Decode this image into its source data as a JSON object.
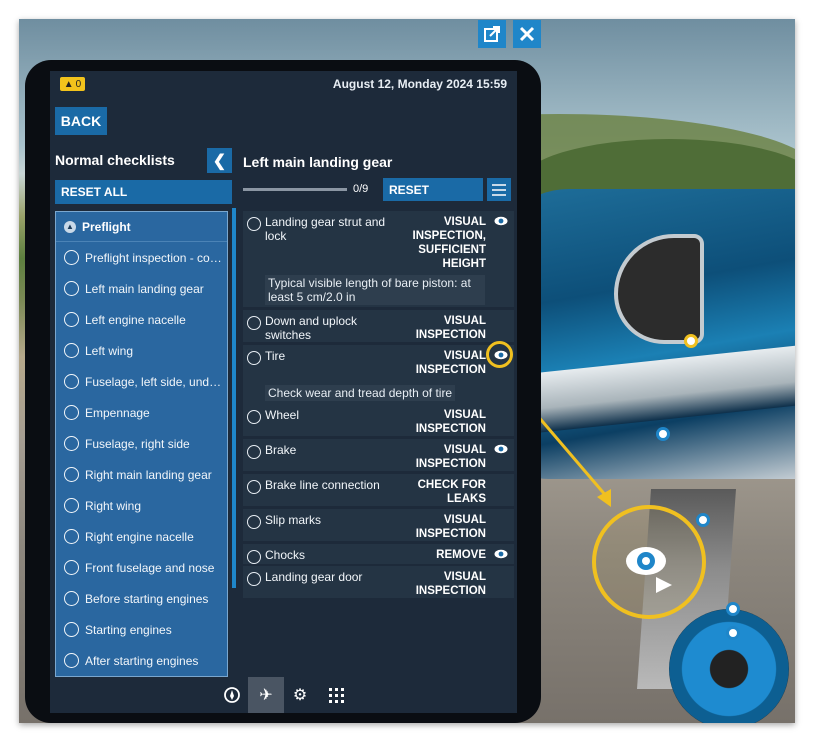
{
  "window": {
    "popout_icon": "popout-icon",
    "close_icon": "close-icon"
  },
  "tablet": {
    "notification_count": "0",
    "datetime": "August 12, Monday 2024 15:59",
    "back_label": "BACK",
    "left_panel": {
      "title": "Normal checklists",
      "reset_all_label": "RESET ALL",
      "group": "Preflight",
      "items": [
        "Preflight inspection - cockpit",
        "Left main landing gear",
        "Left engine nacelle",
        "Left wing",
        "Fuselage, left side, underside",
        "Empennage",
        "Fuselage, right side",
        "Right main landing gear",
        "Right wing",
        "Right engine nacelle",
        "Front fuselage and nose",
        "Before starting engines",
        "Starting engines",
        "After starting engines"
      ]
    },
    "right_panel": {
      "title": "Left main landing gear",
      "progress_text": "0/9",
      "progress_fraction": 0,
      "reset_label": "RESET",
      "checks": [
        {
          "label": "Landing gear strut and lock",
          "action": "VISUAL INSPECTION, SUFFICIENT HEIGHT",
          "eye": true,
          "note": "Typical visible length of bare piston: at least 5 cm/2.0 in"
        },
        {
          "label": "Down and uplock switches",
          "action": "VISUAL INSPECTION",
          "eye": false
        },
        {
          "label": "Tire",
          "action": "VISUAL INSPECTION",
          "eye": true,
          "note": "Check wear and tread depth of tire"
        },
        {
          "label": "Wheel",
          "action": "VISUAL INSPECTION",
          "eye": false
        },
        {
          "label": "Brake",
          "action": "VISUAL INSPECTION",
          "eye": true
        },
        {
          "label": "Brake line connection",
          "action": "CHECK FOR LEAKS",
          "eye": false
        },
        {
          "label": "Slip marks",
          "action": "VISUAL INSPECTION",
          "eye": false
        },
        {
          "label": "Chocks",
          "action": "REMOVE",
          "eye": true
        },
        {
          "label": "Landing gear door",
          "action": "VISUAL INSPECTION",
          "eye": false
        }
      ]
    },
    "bottom_tabs": [
      "compass-icon",
      "airplane-icon",
      "gear-icon",
      "apps-grid-icon"
    ]
  },
  "colors": {
    "accent": "#1a6aa6",
    "highlight": "#f0c020",
    "notification": "#f2c31c"
  }
}
